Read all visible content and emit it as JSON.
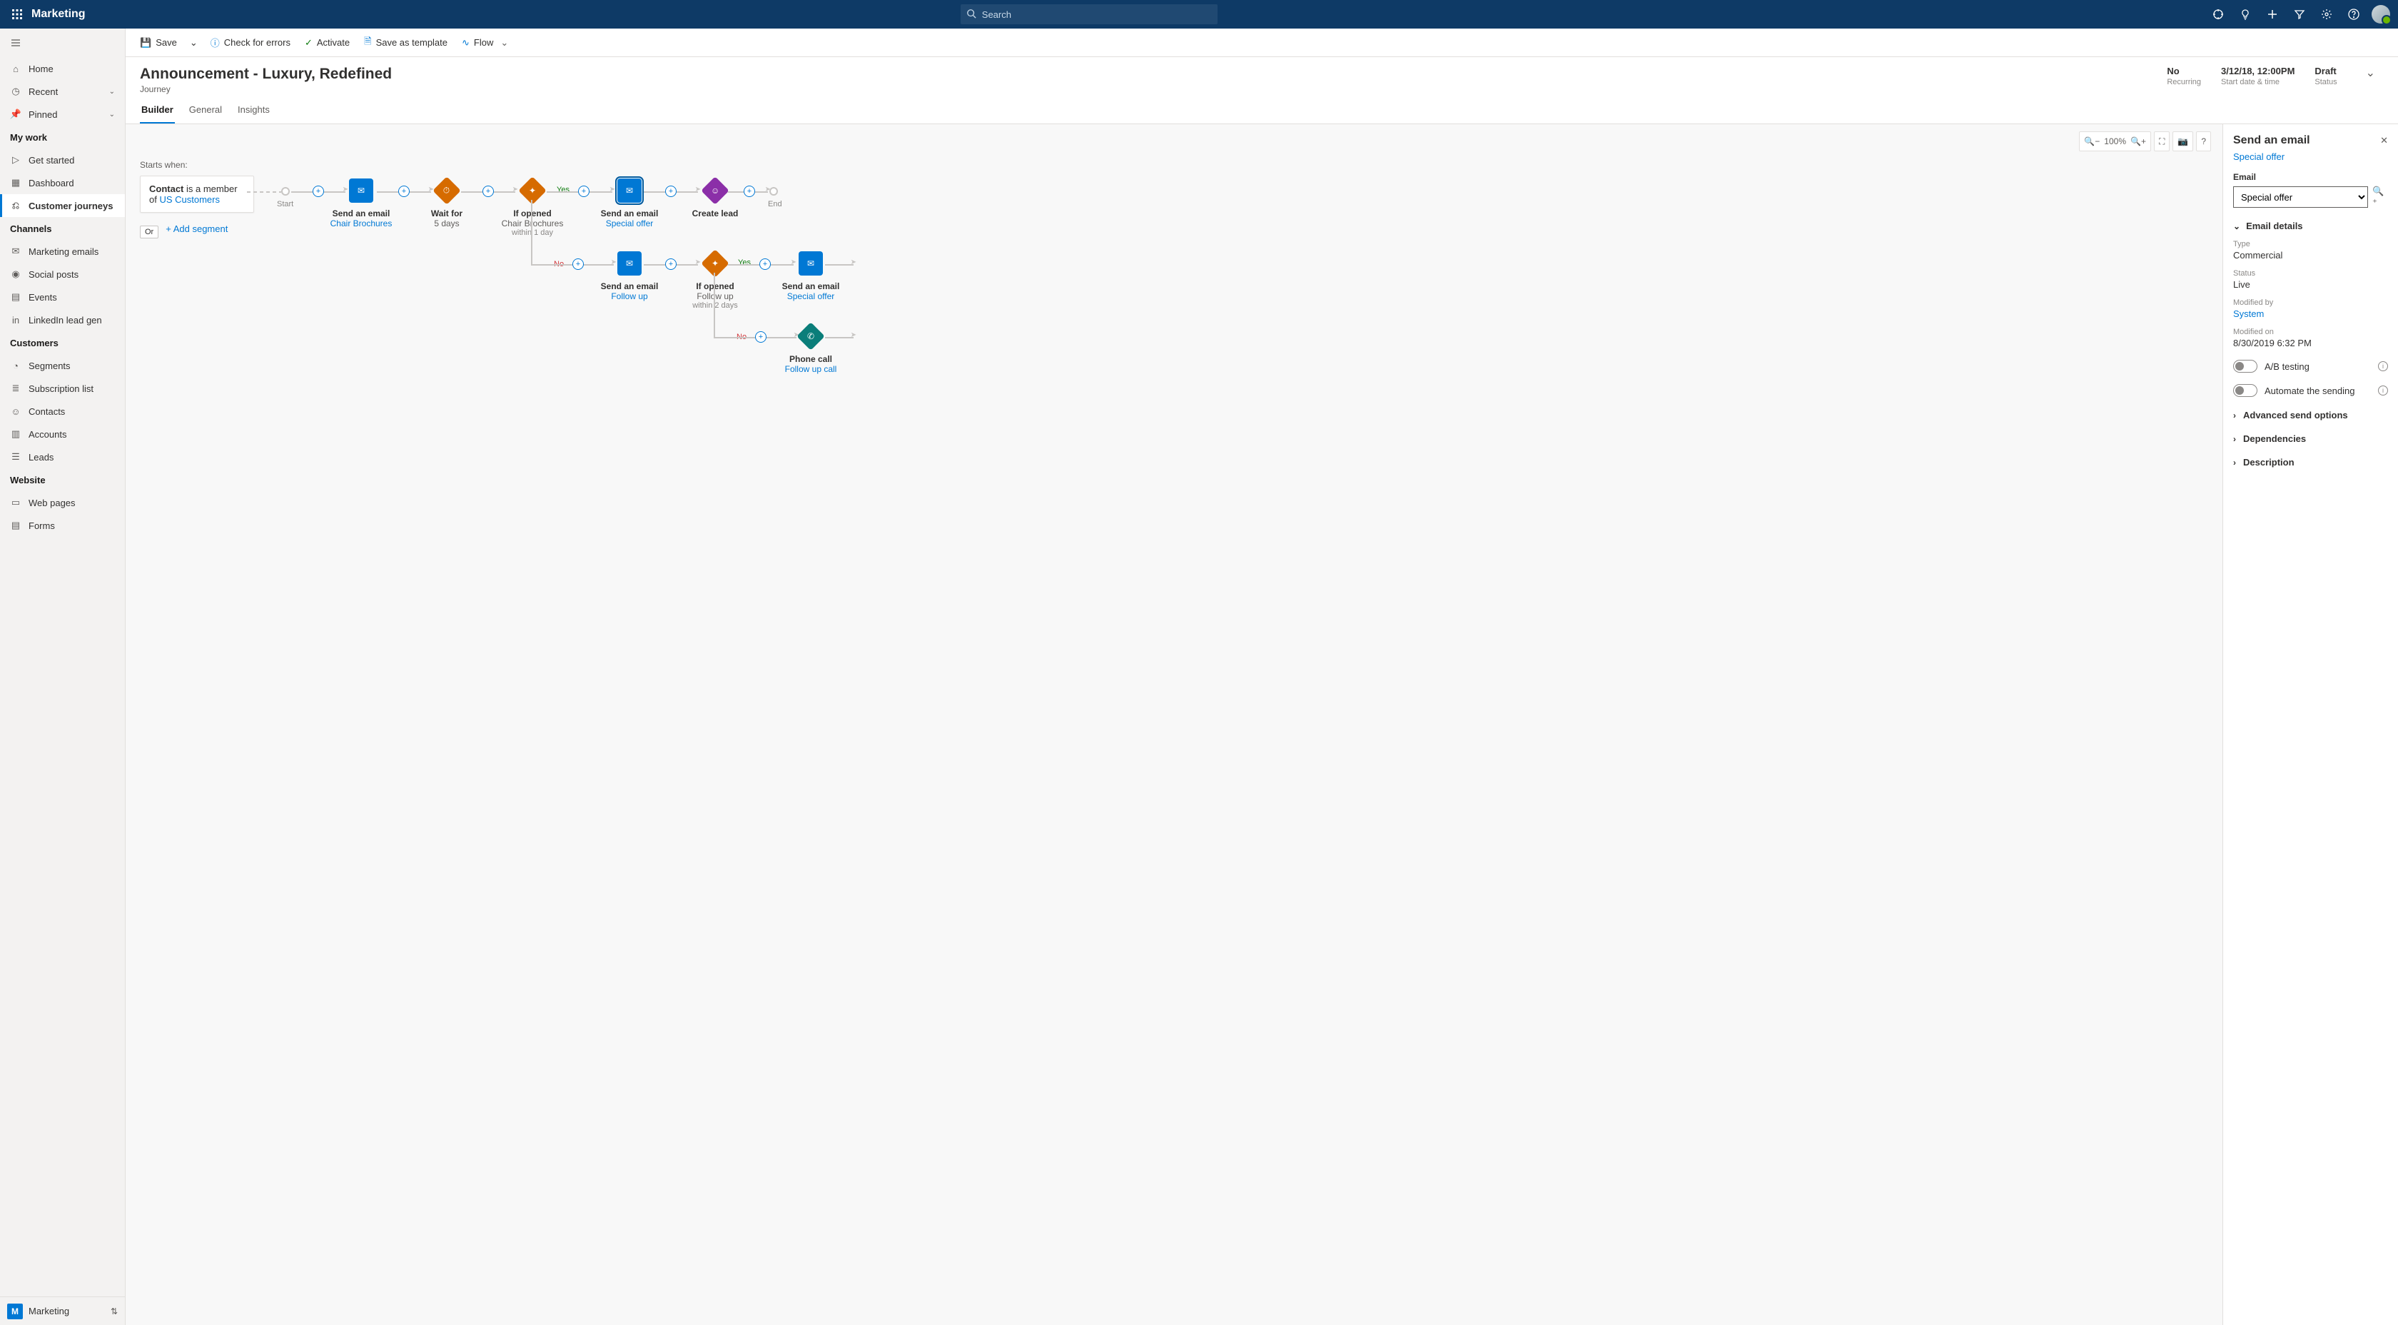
{
  "app_name": "Marketing",
  "search_placeholder": "Search",
  "sidebar": {
    "nav": [
      {
        "label": "Home"
      },
      {
        "label": "Recent",
        "expandable": true
      },
      {
        "label": "Pinned",
        "expandable": true
      }
    ],
    "groups": [
      {
        "title": "My work",
        "items": [
          "Get started",
          "Dashboard",
          "Customer journeys"
        ]
      },
      {
        "title": "Channels",
        "items": [
          "Marketing emails",
          "Social posts",
          "Events",
          "LinkedIn lead gen"
        ]
      },
      {
        "title": "Customers",
        "items": [
          "Segments",
          "Subscription list",
          "Contacts",
          "Accounts",
          "Leads"
        ]
      },
      {
        "title": "Website",
        "items": [
          "Web pages",
          "Forms"
        ]
      }
    ],
    "app_switch_letter": "M",
    "app_switch_label": "Marketing"
  },
  "commands": {
    "save": "Save",
    "check": "Check for errors",
    "activate": "Activate",
    "template": "Save as template",
    "flow": "Flow"
  },
  "header": {
    "title": "Announcement - Luxury, Redefined",
    "subtitle": "Journey",
    "meta": [
      {
        "value": "No",
        "label": "Recurring"
      },
      {
        "value": "3/12/18, 12:00PM",
        "label": "Start date & time"
      },
      {
        "value": "Draft",
        "label": "Status"
      }
    ],
    "tabs": [
      "Builder",
      "General",
      "Insights"
    ]
  },
  "canvas": {
    "zoom": "100%",
    "starts_when": "Starts when:",
    "segment_prefix": "Contact",
    "segment_mid": " is a member of ",
    "segment_link": "US Customers",
    "or": "Or",
    "add_segment": "+ Add segment",
    "start": "Start",
    "end": "End",
    "yes": "Yes",
    "no": "No",
    "nodes": {
      "n1": {
        "title": "Send an email",
        "sub": "Chair Brochures"
      },
      "n2": {
        "title": "Wait for",
        "sub": "5 days"
      },
      "n3": {
        "title": "If opened",
        "sub": "Chair Brochures",
        "ext": "within 1 day"
      },
      "n4": {
        "title": "Send an email",
        "sub": "Special offer"
      },
      "n5": {
        "title": "Create lead"
      },
      "n6": {
        "title": "Send an email",
        "sub": "Follow up"
      },
      "n7": {
        "title": "If opened",
        "sub": "Follow up",
        "ext": "within 2 days"
      },
      "n8": {
        "title": "Send an email",
        "sub": "Special offer"
      },
      "n9": {
        "title": "Phone call",
        "sub": "Follow up call"
      }
    }
  },
  "panel": {
    "title": "Send an email",
    "link": "Special offer",
    "email_label": "Email",
    "email_value": "Special offer",
    "details_title": "Email details",
    "type_label": "Type",
    "type_value": "Commercial",
    "status_label": "Status",
    "status_value": "Live",
    "modby_label": "Modified by",
    "modby_value": "System",
    "modon_label": "Modified on",
    "modon_value": "8/30/2019  6:32 PM",
    "ab": "A/B testing",
    "auto": "Automate the sending",
    "adv": "Advanced send options",
    "dep": "Dependencies",
    "desc": "Description"
  }
}
